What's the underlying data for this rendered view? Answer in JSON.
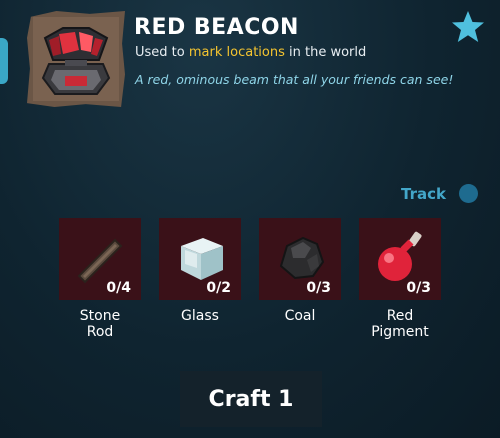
{
  "item": {
    "name": "RED BEACON",
    "usage_prefix": "Used to",
    "usage_highlight": "mark locations",
    "usage_suffix": "in the world",
    "description": "A red, ominous beam that all your friends can see!"
  },
  "icons": {
    "item": "red-beacon-icon",
    "favorite": "star-icon"
  },
  "track": {
    "label": "Track",
    "enabled": false
  },
  "ingredients": [
    {
      "name_line1": "Stone",
      "name_line2": "Rod",
      "count": "0/4",
      "icon": "stone-rod-icon"
    },
    {
      "name_line1": "Glass",
      "name_line2": "",
      "count": "0/2",
      "icon": "glass-icon"
    },
    {
      "name_line1": "Coal",
      "name_line2": "",
      "count": "0/3",
      "icon": "coal-icon"
    },
    {
      "name_line1": "Red",
      "name_line2": "Pigment",
      "count": "0/3",
      "icon": "red-pigment-icon"
    }
  ],
  "craft": {
    "label": "Craft 1"
  },
  "colors": {
    "accent": "#43a7c9",
    "highlight": "#f4c430",
    "slot_bg": "#3a1118",
    "description": "#8fd5e8"
  }
}
